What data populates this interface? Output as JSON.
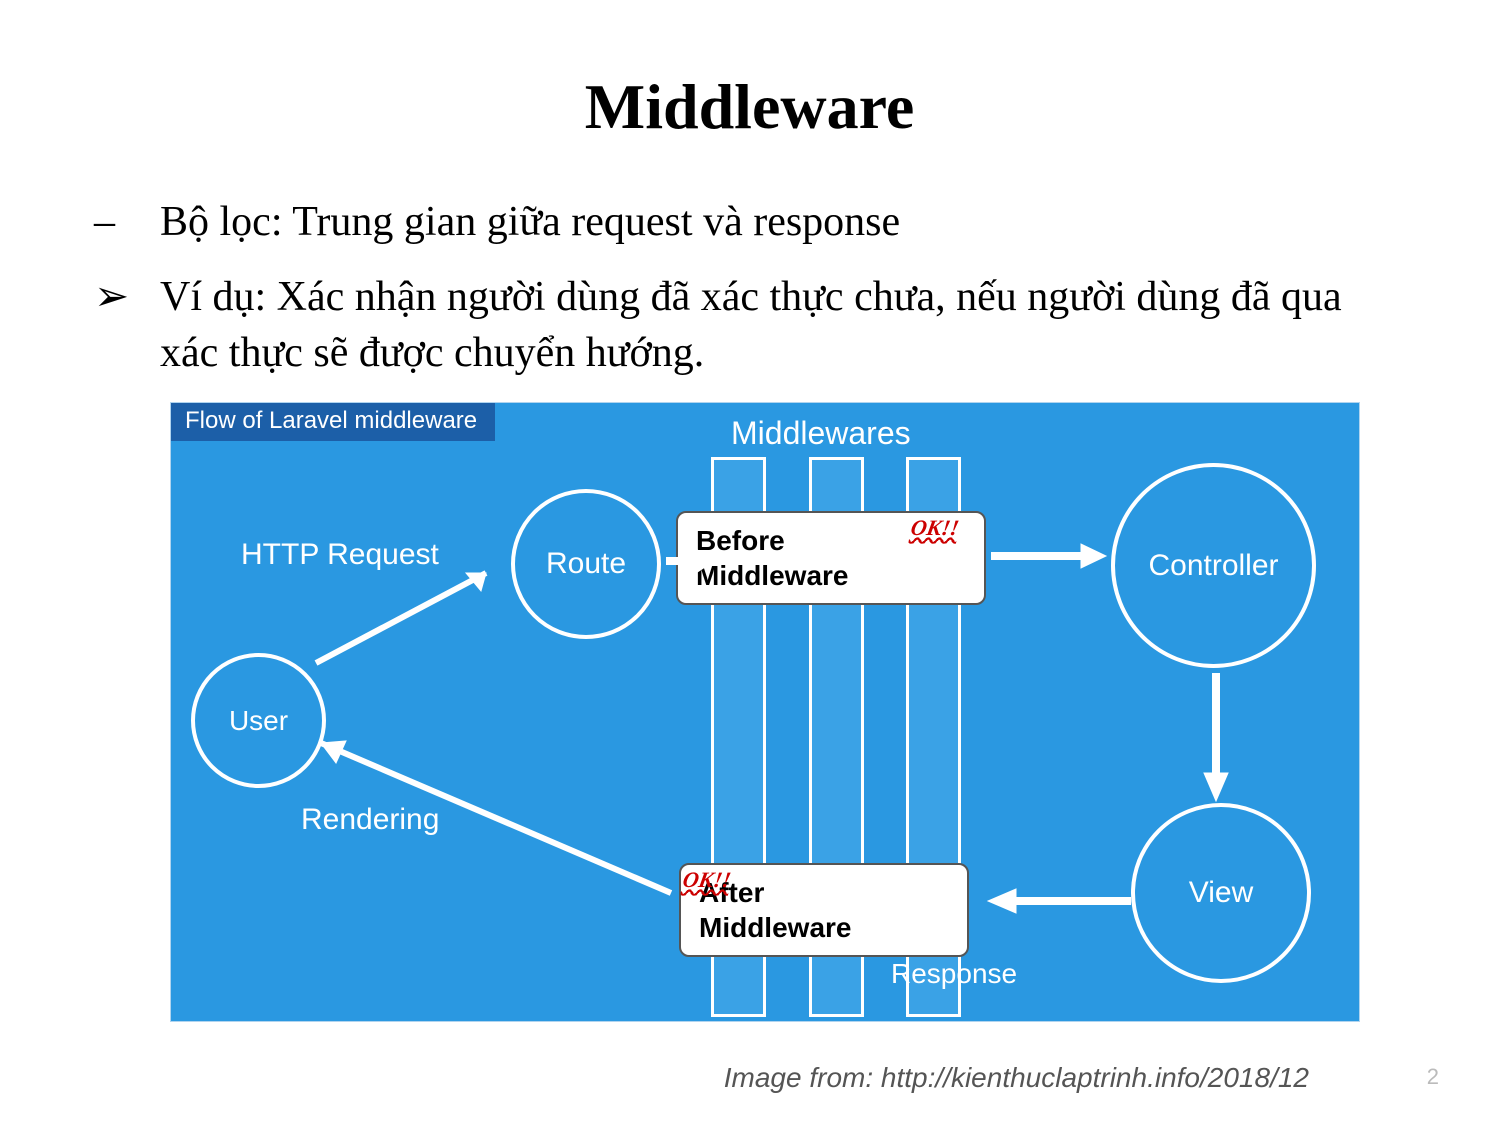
{
  "title": "Middleware",
  "bullets": [
    {
      "marker": "–",
      "text": "Bộ lọc: Trung gian giữa request và response"
    },
    {
      "marker": "➢",
      "text": "Ví dụ: Xác nhận người dùng đã xác thực chưa, nếu người dùng đã qua xác thực sẽ được chuyển hướng."
    }
  ],
  "diagram": {
    "header": "Flow of Laravel middleware",
    "middlewares_label": "Middlewares",
    "http_request": "HTTP Request",
    "rendering": "Rendering",
    "response": "Response",
    "nodes": {
      "user": "User",
      "route": "Route",
      "controller": "Controller",
      "view": "View"
    },
    "boxes": {
      "before": "Before\nMiddleware",
      "after": "After\nMiddleware"
    },
    "ok_stamp": "OK!!"
  },
  "caption": "Image from: http://kienthuclaptrinh.info/2018/12",
  "page_number": "2"
}
